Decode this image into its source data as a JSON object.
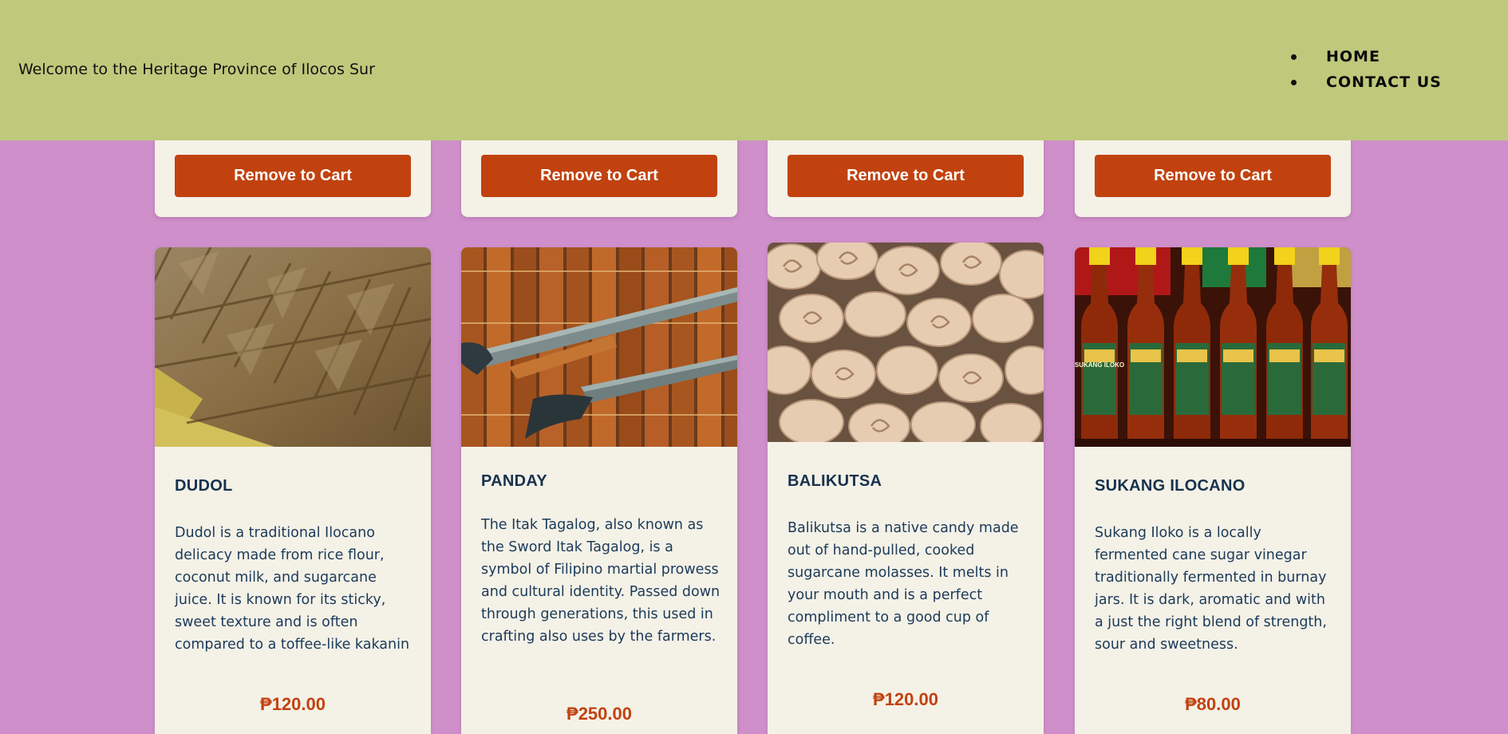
{
  "header": {
    "welcome": "Welcome to the Heritage Province of Ilocos Sur",
    "nav": [
      "HOME",
      "CONTACT US"
    ]
  },
  "cart_button_label": "Remove to Cart",
  "products": [
    {
      "name": "DUDOL",
      "image": "dudol-photo",
      "description": "Dudol is a traditional Ilocano delicacy made from rice flour, coconut milk, and sugarcane juice. It is known for its sticky, sweet texture and is often compared to a toffee-like kakanin",
      "price": "₱120.00"
    },
    {
      "name": "PANDAY",
      "image": "panday-bolo-knives-photo",
      "description": "The Itak Tagalog, also known as the Sword Itak Tagalog, is a symbol of Filipino martial prowess and cultural identity. Passed down through generations, this used in crafting also uses by the farmers.",
      "price": "₱250.00"
    },
    {
      "name": "BALIKUTSA",
      "image": "balikutsa-candy-photo",
      "description": "Balikutsa is a native candy made out of hand-pulled, cooked sugarcane molasses. It melts in your mouth and is a perfect compliment to a good cup of coffee.",
      "price": "₱120.00"
    },
    {
      "name": "SUKANG ILOCANO",
      "image": "sukang-iloko-bottles-photo",
      "description": "Sukang Iloko is a locally fermented cane sugar vinegar traditionally fermented in burnay jars. It is dark, aromatic and with a just the right blend of strength, sour and sweetness.",
      "price": "₱80.00"
    }
  ],
  "bottle_label": "SUKANG ILOKO",
  "colors": {
    "header_bg": "#bfc97c",
    "page_bg": "#cf8fca",
    "card_bg": "#f4f1e7",
    "accent": "#c1420f",
    "title": "#16324d"
  }
}
